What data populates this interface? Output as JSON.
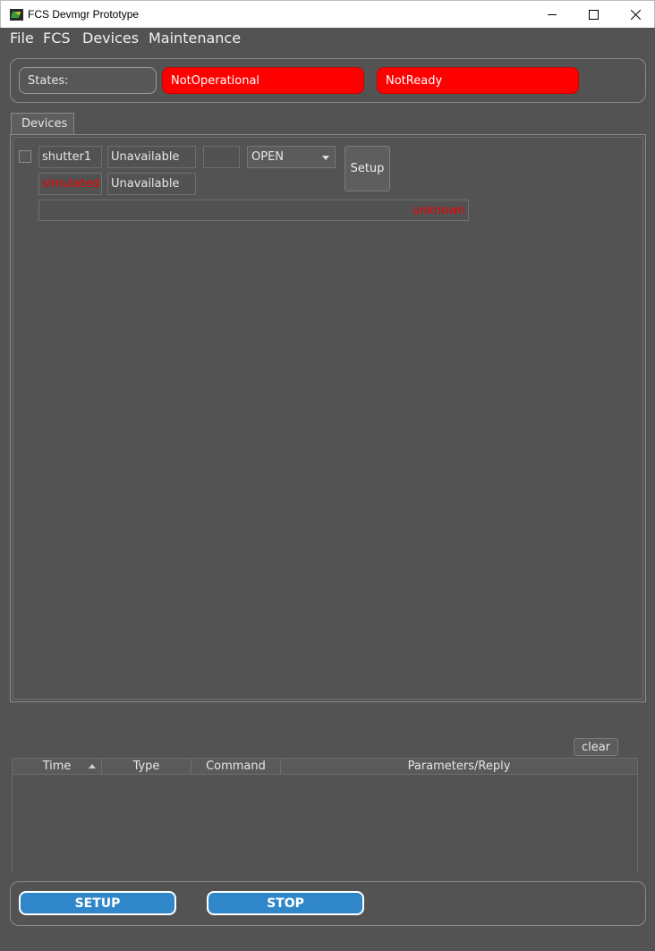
{
  "window": {
    "title": "FCS Devmgr Prototype"
  },
  "menu": [
    "File",
    "FCS",
    "Devices",
    "Maintenance"
  ],
  "states": {
    "label": "States:",
    "values": [
      "NotOperational",
      "NotReady"
    ],
    "status_color": "#ff0000"
  },
  "tabs": [
    {
      "label": "Devices"
    }
  ],
  "device": {
    "name": "shutter1",
    "mode": "simulated",
    "status1": "Unavailable",
    "status2": "Unavailable",
    "value": "",
    "command_selected": "OPEN",
    "setup_label": "Setup",
    "state_text": "unknown"
  },
  "log": {
    "clear_label": "clear",
    "columns": [
      "Time",
      "Type",
      "Command",
      "Parameters/Reply"
    ],
    "rows": []
  },
  "actions": {
    "setup_label": "SETUP",
    "stop_label": "STOP",
    "accent": "#2f87c9"
  }
}
